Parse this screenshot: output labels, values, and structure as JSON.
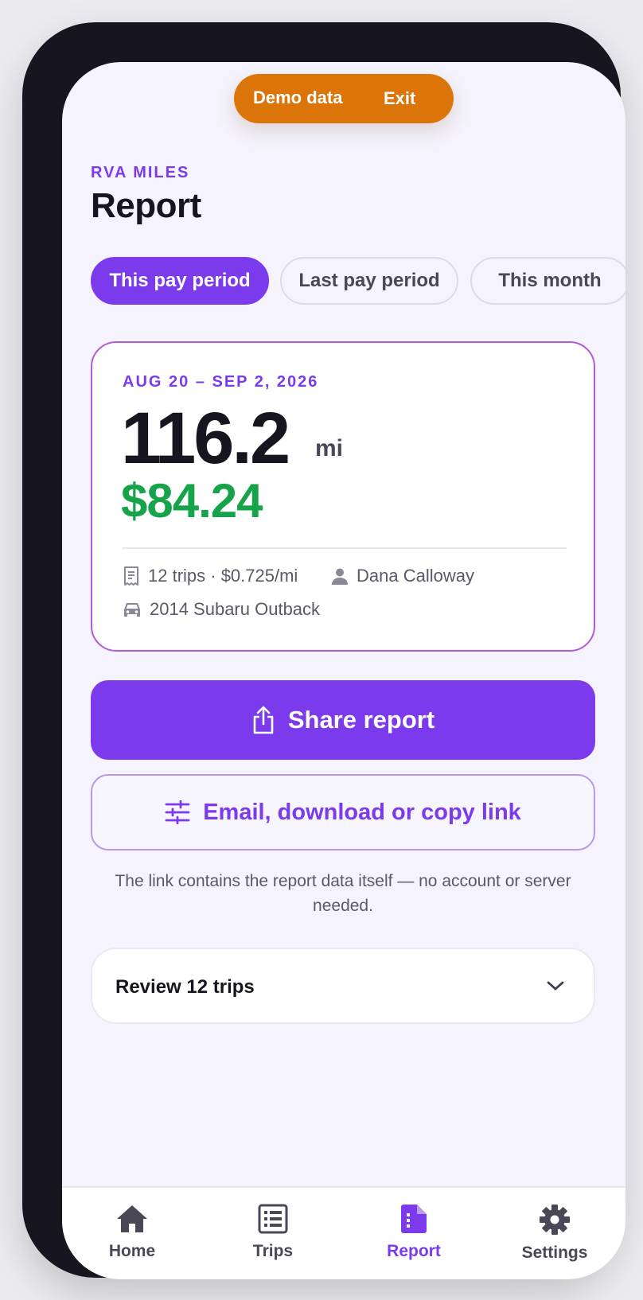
{
  "demo_banner": {
    "label": "Demo data",
    "exit_label": "Exit"
  },
  "header": {
    "brand": "RVA MILES",
    "title": "Report"
  },
  "tabs": [
    {
      "label": "This pay period",
      "active": true
    },
    {
      "label": "Last pay period",
      "active": false
    },
    {
      "label": "This month",
      "active": false
    }
  ],
  "summary": {
    "date_range": "AUG 20 – SEP 2, 2026",
    "miles": "116.2",
    "unit": "mi",
    "amount": "$84.24",
    "trips_rate": "12 trips · $0.725/mi",
    "driver": "Dana Calloway",
    "vehicle": "2014 Subaru Outback"
  },
  "actions": {
    "share_label": "Share report",
    "email_label": "Email, download or copy link",
    "note": "The link contains the report data itself — no account or server needed."
  },
  "review": {
    "label": "Review 12 trips"
  },
  "nav": [
    {
      "label": "Home",
      "icon": "home-icon"
    },
    {
      "label": "Trips",
      "icon": "list-icon"
    },
    {
      "label": "Report",
      "icon": "report-icon",
      "active": true
    },
    {
      "label": "Settings",
      "icon": "gear-icon"
    }
  ],
  "colors": {
    "accent": "#7c3aed",
    "money": "#16a34a",
    "demo_banner": "#dc7509",
    "phone_frame": "#17151f"
  }
}
